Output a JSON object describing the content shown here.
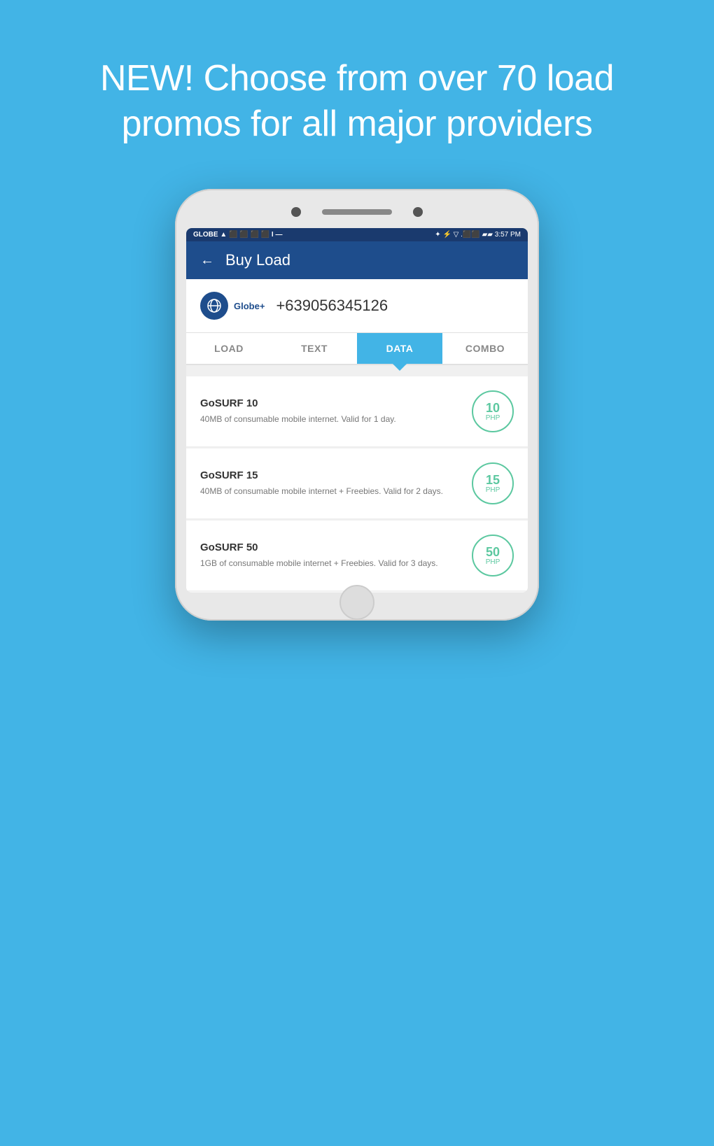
{
  "hero": {
    "text": "NEW! Choose from over 70 load promos for all major providers"
  },
  "status_bar": {
    "left": "GLOBE ▲ ⬛ ⬛ ⬛ ⬛ I —",
    "right": "✦ ⚡ ▽ .⬛⬛ ▰▰ 3:57 PM"
  },
  "header": {
    "title": "Buy Load",
    "back_label": "←"
  },
  "phone_number_row": {
    "provider": "Globe+",
    "number": "+639056345126"
  },
  "tabs": [
    {
      "label": "LOAD",
      "active": false
    },
    {
      "label": "TEXT",
      "active": false
    },
    {
      "label": "DATA",
      "active": true
    },
    {
      "label": "COMBO",
      "active": false
    }
  ],
  "promos": [
    {
      "name": "GoSURF 10",
      "description": "40MB of consumable mobile internet. Valid for 1 day.",
      "price": "10",
      "unit": "PHP"
    },
    {
      "name": "GoSURF 15",
      "description": "40MB of consumable mobile internet + Freebies. Valid for 2 days.",
      "price": "15",
      "unit": "PHP"
    },
    {
      "name": "GoSURF 50",
      "description": "1GB of consumable mobile internet + Freebies. Valid for 3 days.",
      "price": "50",
      "unit": "PHP"
    }
  ]
}
